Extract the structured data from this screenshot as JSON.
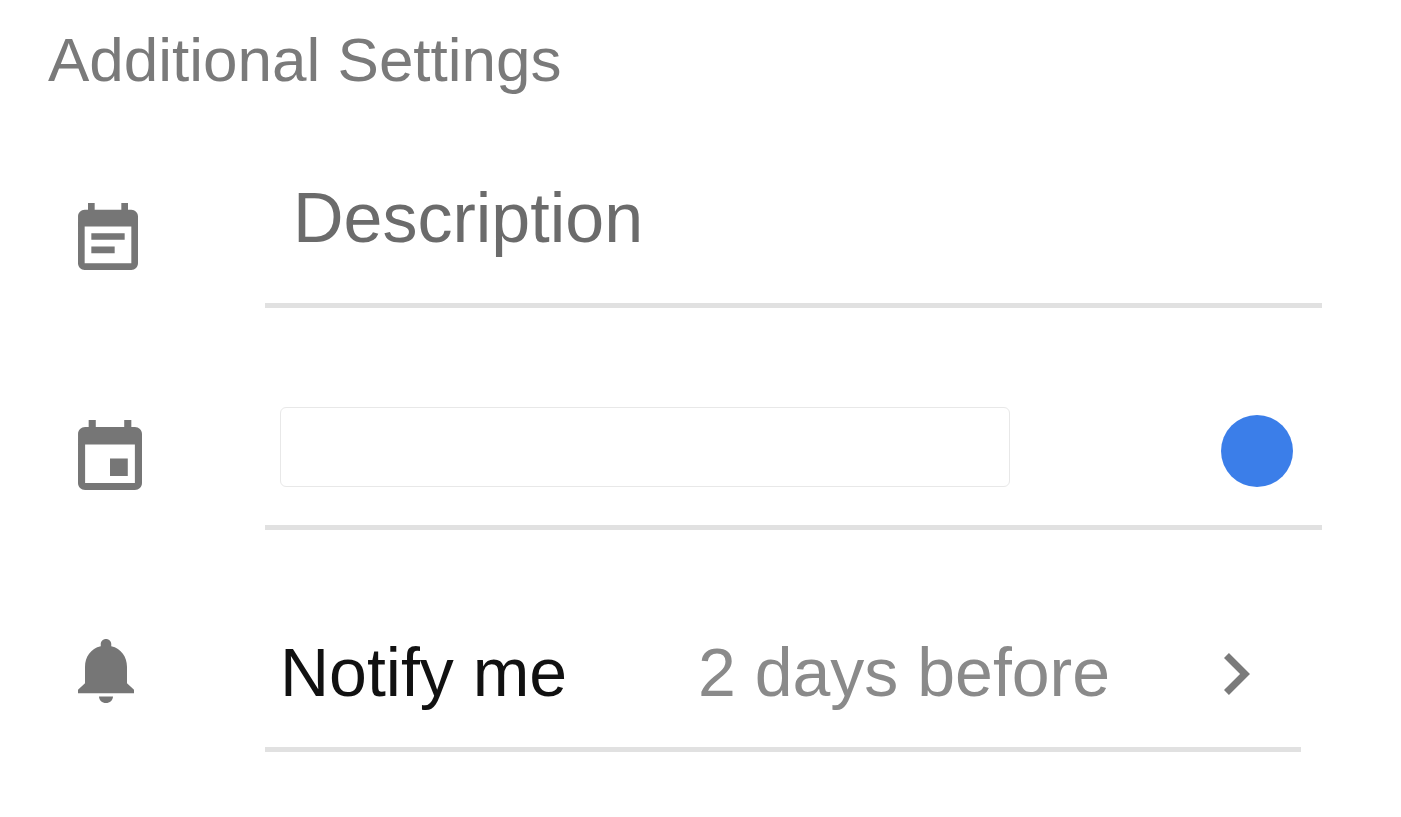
{
  "section_title": "Additional Settings",
  "rows": [
    {
      "kind": "text_input",
      "placeholder": "Description"
    },
    {
      "kind": "color",
      "color": "#3b7ee9"
    },
    {
      "kind": "option",
      "label": "Notify me",
      "value": "2 days before"
    }
  ]
}
